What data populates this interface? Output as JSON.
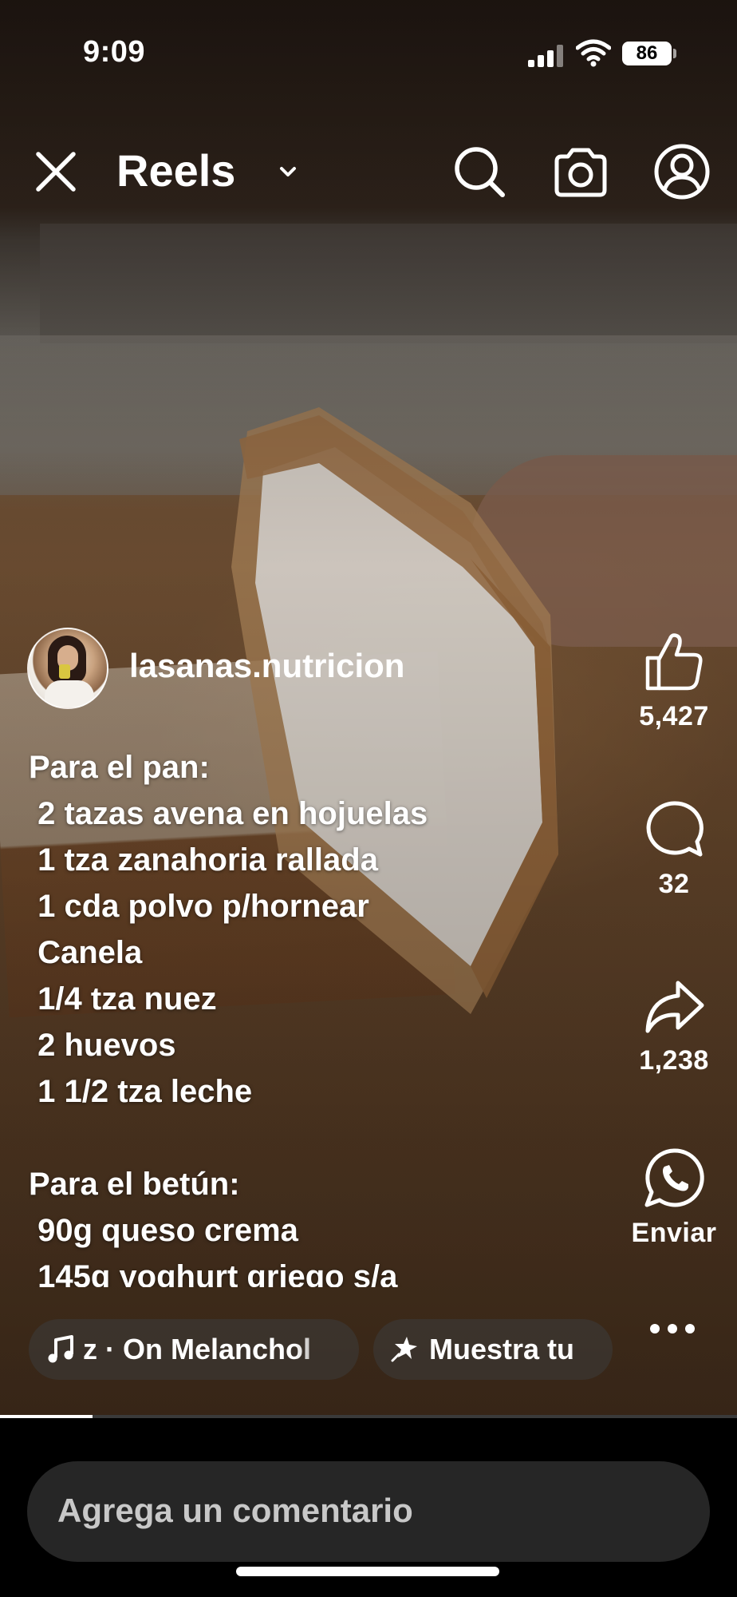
{
  "status_bar": {
    "time": "9:09",
    "battery": "86"
  },
  "header": {
    "title": "Reels"
  },
  "post": {
    "username": "lasanas.nutricion",
    "caption_lines": [
      "Para el pan:",
      " 2 tazas avena en hojuelas",
      " 1 tza zanahoria rallada",
      " 1 cda polvo p/hornear",
      " Canela",
      " 1/4 tza nuez",
      " 2 huevos",
      " 1 1/2 tza leche",
      "",
      "Para el betún:",
      " 90g queso crema",
      " 145g yoghurt griego s/a"
    ],
    "audio_label": "z · On Melanchol",
    "effect_label": "Muestra tu"
  },
  "actions": {
    "likes": "5,427",
    "comments": "32",
    "shares": "1,238",
    "send_label": "Enviar"
  },
  "playback": {
    "progress": 0.125
  },
  "comment_input": {
    "placeholder": "Agrega un comentario"
  },
  "colors": {
    "background": "#000000",
    "input_bg": "#262626",
    "text": "#ffffff"
  },
  "icons": [
    "close-icon",
    "chevron-down-icon",
    "search-icon",
    "camera-icon",
    "profile-icon",
    "like-icon",
    "comment-icon",
    "share-icon",
    "whatsapp-icon",
    "more-icon",
    "music-note-icon",
    "effect-sparkle-icon"
  ]
}
